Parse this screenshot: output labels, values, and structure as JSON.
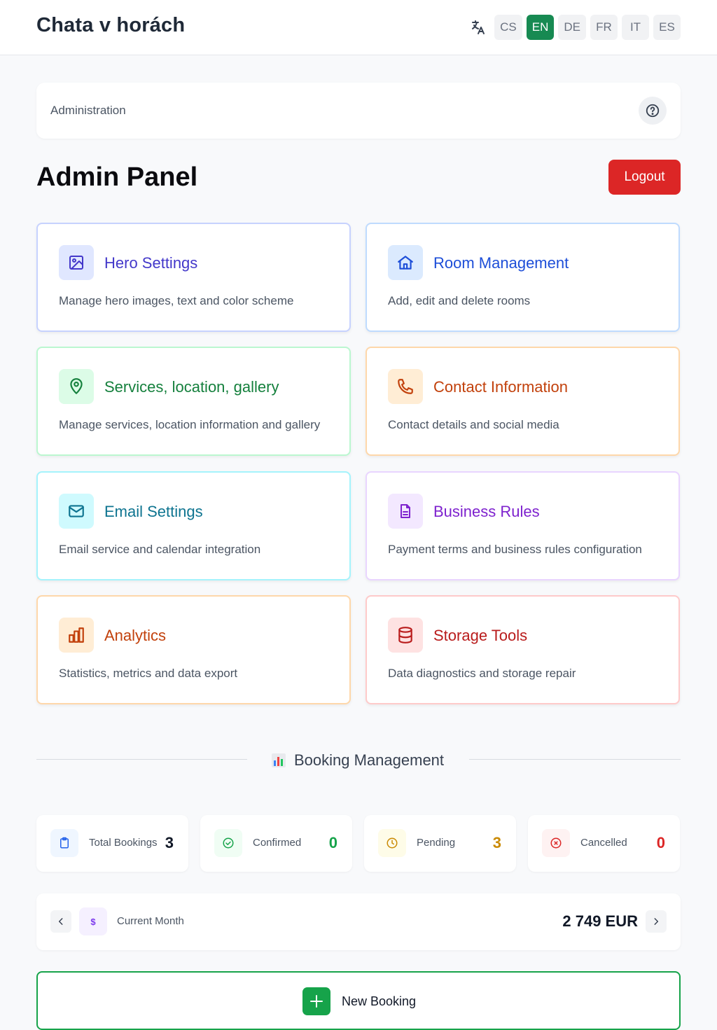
{
  "header": {
    "brand": "Chata v horách",
    "languages": [
      "CS",
      "EN",
      "DE",
      "FR",
      "IT",
      "ES"
    ],
    "active_language": "EN"
  },
  "breadcrumb": {
    "label": "Administration"
  },
  "page": {
    "title": "Admin Panel",
    "logout_label": "Logout"
  },
  "cards": [
    {
      "title": "Hero Settings",
      "description": "Manage hero images, text and color scheme",
      "icon": "image-icon",
      "color": "#4338ca",
      "border": "#c7d2fe",
      "icon_bg": "#e0e7ff"
    },
    {
      "title": "Room Management",
      "description": "Add, edit and delete rooms",
      "icon": "home-icon",
      "color": "#1d4ed8",
      "border": "#bfdbfe",
      "icon_bg": "#dbeafe"
    },
    {
      "title": "Services, location, gallery",
      "description": "Manage services, location information and gallery",
      "icon": "map-pin-icon",
      "color": "#15803d",
      "border": "#bbf7d0",
      "icon_bg": "#dcfce7"
    },
    {
      "title": "Contact Information",
      "description": "Contact details and social media",
      "icon": "phone-icon",
      "color": "#c2410c",
      "border": "#fed7aa",
      "icon_bg": "#ffedd5"
    },
    {
      "title": "Email Settings",
      "description": "Email service and calendar integration",
      "icon": "mail-icon",
      "color": "#0e7490",
      "border": "#a5f3fc",
      "icon_bg": "#cffafe"
    },
    {
      "title": "Business Rules",
      "description": "Payment terms and business rules configuration",
      "icon": "document-icon",
      "color": "#7e22ce",
      "border": "#e9d5ff",
      "icon_bg": "#f3e8ff"
    },
    {
      "title": "Analytics",
      "description": "Statistics, metrics and data export",
      "icon": "bar-chart-icon",
      "color": "#c2410c",
      "border": "#fed7aa",
      "icon_bg": "#ffedd5"
    },
    {
      "title": "Storage Tools",
      "description": "Data diagnostics and storage repair",
      "icon": "database-icon",
      "color": "#b91c1c",
      "border": "#fecaca",
      "icon_bg": "#fee2e2"
    }
  ],
  "booking_section": {
    "title": "Booking Management",
    "icon": "bar-chart-emoji-icon"
  },
  "stats": [
    {
      "label": "Total Bookings",
      "value": "3",
      "icon": "clipboard-icon",
      "color": "#111827",
      "icon_color": "#2563eb",
      "icon_bg": "#eff6ff"
    },
    {
      "label": "Confirmed",
      "value": "0",
      "icon": "check-circle-icon",
      "color": "#16a34a",
      "icon_color": "#16a34a",
      "icon_bg": "#f0fdf4"
    },
    {
      "label": "Pending",
      "value": "3",
      "icon": "clock-icon",
      "color": "#ca8a04",
      "icon_color": "#ca8a04",
      "icon_bg": "#fefce8"
    },
    {
      "label": "Cancelled",
      "value": "0",
      "icon": "x-circle-icon",
      "color": "#dc2626",
      "icon_color": "#dc2626",
      "icon_bg": "#fef2f2"
    }
  ],
  "month": {
    "label": "Current Month",
    "value": "2 749 EUR",
    "currency_symbol": "$"
  },
  "new_booking": {
    "label": "New Booking"
  }
}
